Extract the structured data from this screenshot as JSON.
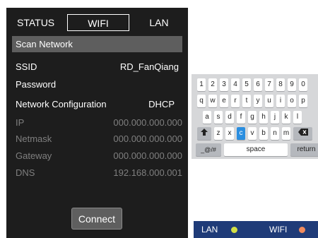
{
  "tabs": {
    "status": "STATUS",
    "wifi": "WIFI",
    "lan": "LAN"
  },
  "scan_label": "Scan Network",
  "fields": [
    {
      "label": "SSID",
      "value": "RD_FanQiang",
      "enabled": true
    },
    {
      "label": "Password",
      "value": "",
      "enabled": true
    },
    {
      "label": "Network Configuration",
      "value": "DHCP",
      "enabled": true
    },
    {
      "label": "IP",
      "value": "000.000.000.000",
      "enabled": false
    },
    {
      "label": "Netmask",
      "value": "000.000.000.000",
      "enabled": false
    },
    {
      "label": "Gateway",
      "value": "000.000.000.000",
      "enabled": false
    },
    {
      "label": "DNS",
      "value": "192.168.000.001",
      "enabled": false
    }
  ],
  "connect_label": "Connect",
  "keyboard": {
    "rows": [
      [
        "1",
        "2",
        "3",
        "4",
        "5",
        "6",
        "7",
        "8",
        "9",
        "0"
      ],
      [
        "q",
        "w",
        "e",
        "r",
        "t",
        "y",
        "u",
        "i",
        "o",
        "p"
      ],
      [
        "a",
        "s",
        "d",
        "f",
        "g",
        "h",
        "j",
        "k",
        "l"
      ],
      [
        "z",
        "x",
        "c",
        "v",
        "b",
        "n",
        "m"
      ]
    ],
    "selected_key": "c",
    "shift_icon": "shift-icon",
    "backspace_icon": "backspace-icon",
    "symbols_label": "_@/#",
    "space_label": "space",
    "return_label": "return"
  },
  "status_bar": {
    "lan_label": "LAN",
    "lan_color": "#d3df45",
    "wifi_label": "WIFI",
    "wifi_color": "#f08a5d"
  }
}
